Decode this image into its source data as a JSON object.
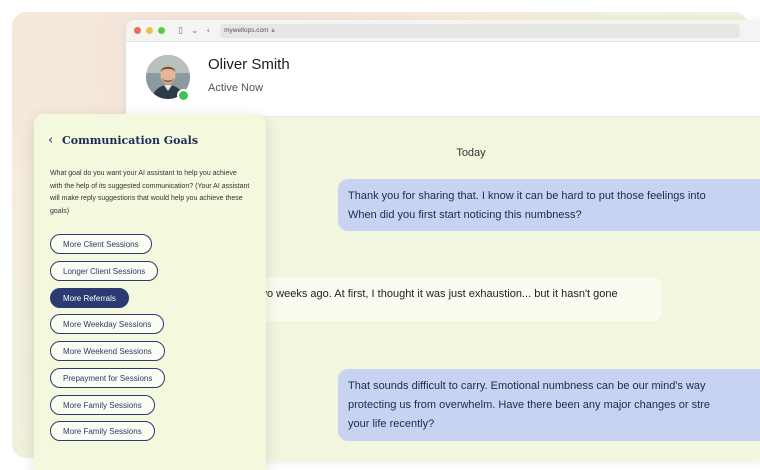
{
  "browser": {
    "url": "mywellops.com"
  },
  "contact": {
    "name": "Oliver Smith",
    "status": "Active Now",
    "status_color": "#3cc552"
  },
  "chat": {
    "date_label": "Today",
    "messages": [
      {
        "type": "sent",
        "line1": "Thank you for sharing that. I know it can be hard to put those feelings into",
        "line2": "When did you first start noticing this numbness?"
      },
      {
        "type": "received",
        "line1": "two weeks ago. At first, I thought it was just exhaustion... but it hasn't gone"
      },
      {
        "type": "sent",
        "line1": "That sounds difficult to carry. Emotional numbness can be our mind's way",
        "line2": "protecting us from overwhelm. Have there been any major changes or stre",
        "line3": "your life recently?"
      }
    ]
  },
  "panel": {
    "title": "Communication Goals",
    "description": "What goal do you want your AI assistant to help you achieve with the help of its suggested communication? (Your AI assistant will make reply suggestions that would help you achieve these goals)",
    "goals": [
      {
        "label": "More Client Sessions",
        "selected": false
      },
      {
        "label": "Longer Client Sessions",
        "selected": false
      },
      {
        "label": "More Referrals",
        "selected": true
      },
      {
        "label": "More Weekday Sessions",
        "selected": false
      },
      {
        "label": "More Weekend Sessions",
        "selected": false
      },
      {
        "label": "Prepayment for Sessions",
        "selected": false
      },
      {
        "label": "More Family Sessions",
        "selected": false
      },
      {
        "label": "More Family Sessions",
        "selected": false
      }
    ],
    "accent_color": "#2b3a73"
  }
}
